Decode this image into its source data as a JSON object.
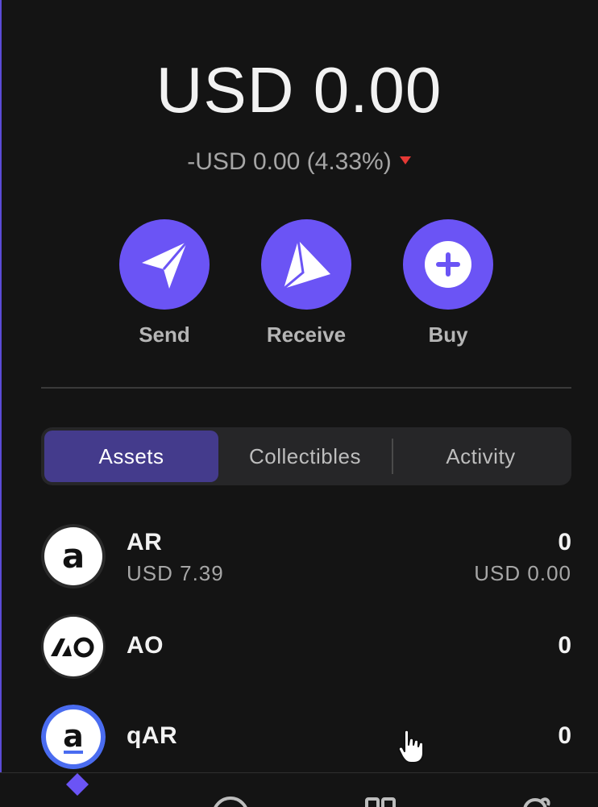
{
  "balance": {
    "total": "USD 0.00",
    "change": "-USD 0.00 (4.33%)"
  },
  "actions": {
    "send": "Send",
    "receive": "Receive",
    "buy": "Buy"
  },
  "tabs": {
    "assets": "Assets",
    "collectibles": "Collectibles",
    "activity": "Activity",
    "active": "Assets"
  },
  "assets": [
    {
      "symbol": "AR",
      "price": "USD 7.39",
      "amount": "0",
      "value": "USD 0.00",
      "logo": "ar-logo"
    },
    {
      "symbol": "AO",
      "amount": "0",
      "logo": "ao-logo"
    },
    {
      "symbol": "qAR",
      "amount": "0",
      "logo": "qar-logo"
    }
  ],
  "colors": {
    "accent": "#6b54f5",
    "active_tab": "#443b8c",
    "negative": "#e53935",
    "background": "#141414"
  }
}
